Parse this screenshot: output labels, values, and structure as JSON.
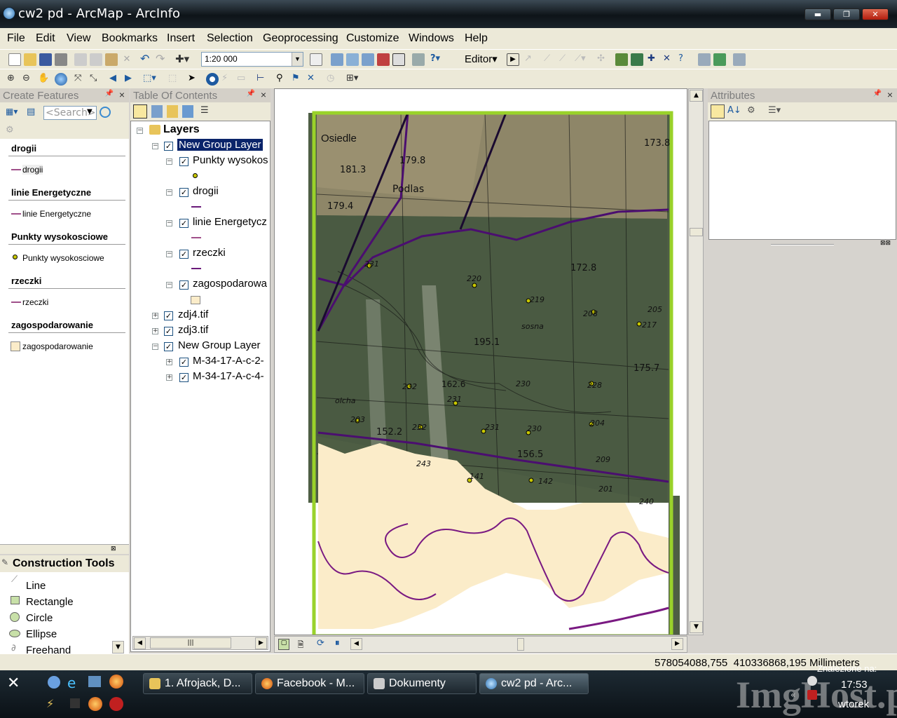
{
  "window": {
    "title": "cw2 pd - ArcMap - ArcInfo",
    "min": "▬",
    "max": "❐",
    "close": "✕"
  },
  "menu": [
    "File",
    "Edit",
    "View",
    "Bookmarks",
    "Insert",
    "Selection",
    "Geoprocessing",
    "Customize",
    "Windows",
    "Help"
  ],
  "toolbar": {
    "scale": "1:20 000",
    "editor": "Editor▾"
  },
  "create_features": {
    "title": "Create Features",
    "search_placeholder": "<Search>",
    "groups": [
      {
        "header": "drogii",
        "item": "drogii",
        "sym": "line",
        "color": "#a0508a"
      },
      {
        "header": "linie Energetyczne",
        "item": "linie Energetyczne",
        "sym": "line",
        "color": "#a0508a"
      },
      {
        "header": "Punkty wysokosciowe",
        "item": "Punkty wysokosciowe",
        "sym": "point",
        "color": "#c8c800"
      },
      {
        "header": "rzeczki",
        "item": "rzeczki",
        "sym": "line",
        "color": "#a0508a"
      },
      {
        "header": "zagospodarowanie",
        "item": "zagospodarowanie",
        "sym": "fill",
        "color": "#fbecc9"
      }
    ]
  },
  "construction_tools": {
    "title": "Construction Tools",
    "items": [
      "Line",
      "Rectangle",
      "Circle",
      "Ellipse",
      "Freehand"
    ]
  },
  "toc": {
    "title": "Table Of Contents",
    "root": "Layers",
    "layers": [
      {
        "name": "New Group Layer",
        "level": 0,
        "expanded": true,
        "selected": true,
        "checked": true
      },
      {
        "name": "Punkty wysokos",
        "level": 1,
        "expanded": true,
        "checked": true,
        "sym": "point"
      },
      {
        "name": "drogii",
        "level": 1,
        "expanded": true,
        "checked": true,
        "sym": "line"
      },
      {
        "name": "linie Energetycz",
        "level": 1,
        "expanded": true,
        "checked": true,
        "sym": "line"
      },
      {
        "name": "rzeczki",
        "level": 1,
        "expanded": true,
        "checked": true,
        "sym": "line"
      },
      {
        "name": "zagospodarowa",
        "level": 1,
        "expanded": true,
        "checked": true,
        "sym": "fill"
      },
      {
        "name": "zdj4.tif",
        "level": 0,
        "expanded": false,
        "checked": true
      },
      {
        "name": "zdj3.tif",
        "level": 0,
        "expanded": false,
        "checked": true
      },
      {
        "name": "New Group Layer",
        "level": 0,
        "expanded": true,
        "checked": true
      },
      {
        "name": "M-34-17-A-c-2-",
        "level": 1,
        "expanded": false,
        "checked": true
      },
      {
        "name": "M-34-17-A-c-4-",
        "level": 1,
        "expanded": false,
        "checked": true
      }
    ]
  },
  "attributes": {
    "title": "Attributes"
  },
  "map_labels": [
    "Osiedle",
    "179.8",
    "181.3",
    "Podlas",
    "179.4",
    "173.8",
    "172.8",
    "231",
    "220",
    "219",
    "208",
    "205",
    "217",
    "195.1",
    "sosna",
    "175.7",
    "232",
    "162.6",
    "230",
    "228",
    "231",
    "203",
    "152.2",
    "232",
    "231",
    "230",
    "204",
    "209",
    "156.5",
    "243",
    "141",
    "142",
    "201",
    "240",
    "olcha"
  ],
  "status": {
    "coords": "578054088,755  410336868,195 Millimeters"
  },
  "taskbar": {
    "buttons": [
      "1. Afrojack, D...",
      "Facebook - M...",
      "Dokumenty",
      "cw2 pd - Arc..."
    ],
    "clock": "17:53",
    "day": "wtorek",
    "found": "Znalezione na:",
    "watermark": "ImgHost.pl"
  }
}
